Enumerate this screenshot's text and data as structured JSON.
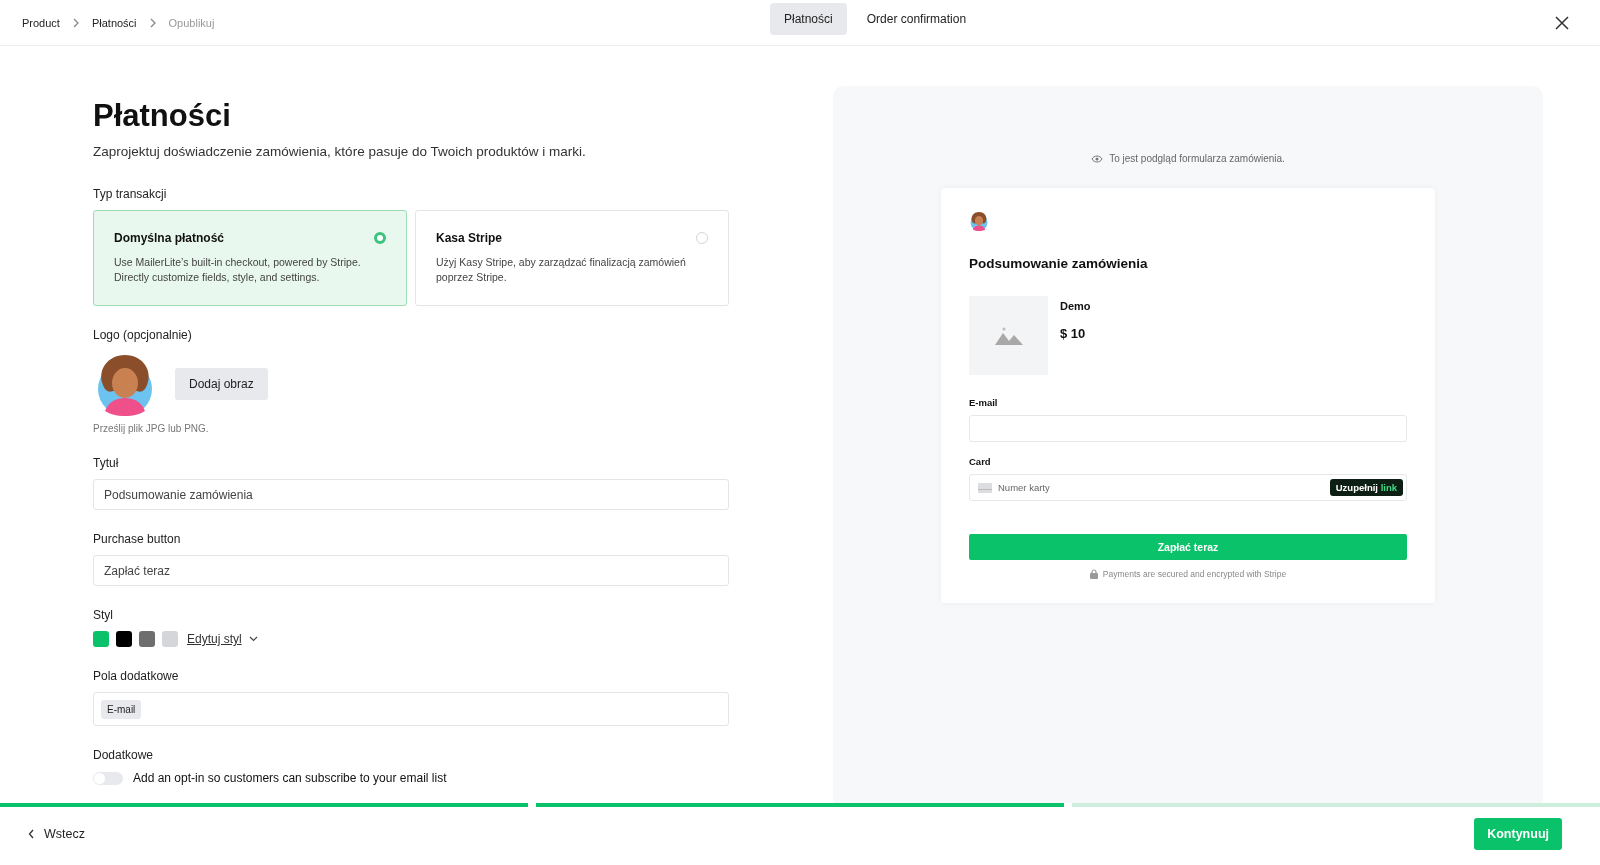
{
  "breadcrumb": [
    {
      "label": "Product",
      "disabled": false
    },
    {
      "label": "Płatności",
      "disabled": false
    },
    {
      "label": "Opublikuj",
      "disabled": true
    }
  ],
  "tabs": [
    {
      "label": "Płatności",
      "selected": true
    },
    {
      "label": "Order confirmation",
      "selected": false
    }
  ],
  "form": {
    "title": "Płatności",
    "subtitle": "Zaprojektuj doświadczenie zamówienia, które pasuje do Twoich produktów i marki.",
    "transaction_type": {
      "label": "Typ transakcji",
      "options": [
        {
          "title": "Domyślna płatność",
          "description": "Use MailerLite’s built-in checkout, powered by Stripe. Directly customize fields, style, and settings.",
          "selected": true
        },
        {
          "title": "Kasa Stripe",
          "description": "Użyj Kasy Stripe, aby zarządzać finalizacją zamówień poprzez Stripe.",
          "selected": false
        }
      ]
    },
    "logo": {
      "label": "Logo (opcjonalnie)",
      "button": "Dodaj obraz",
      "hint": "Prześlij plik JPG lub PNG."
    },
    "title_field": {
      "label": "Tytuł",
      "value": "Podsumowanie zamówienia"
    },
    "purchase_field": {
      "label": "Purchase button",
      "value": "Zapłać teraz"
    },
    "style": {
      "label": "Styl",
      "swatches": [
        {
          "color": "#09c269"
        },
        {
          "color": "#000000"
        },
        {
          "color": "#6e6e6e"
        },
        {
          "color": "#d4d6da"
        }
      ],
      "edit_link": "Edytuj styl"
    },
    "extra_fields": {
      "label": "Pola dodatkowe",
      "tags": [
        "E-mail"
      ]
    },
    "additional": {
      "label": "Dodatkowe",
      "toggles": [
        {
          "label": "Add an opt-in so customers can subscribe to your email list",
          "on": false
        }
      ]
    }
  },
  "preview": {
    "note": "To jest podgląd formularza zamówienia.",
    "heading": "Podsumowanie zamówienia",
    "product": {
      "name": "Demo",
      "price": "$ 10"
    },
    "email_label": "E-mail",
    "card_label": "Card",
    "card_placeholder": "Numer karty",
    "autofill": {
      "text": "Uzupełnij",
      "link": "link"
    },
    "pay_button": "Zapłać teraz",
    "secure_note": "Payments are secured and encrypted with Stripe"
  },
  "footer": {
    "back": "Wstecz",
    "continue": "Kontynuuj",
    "progress": [
      {
        "done": true
      },
      {
        "done": true
      },
      {
        "done": false
      }
    ]
  }
}
